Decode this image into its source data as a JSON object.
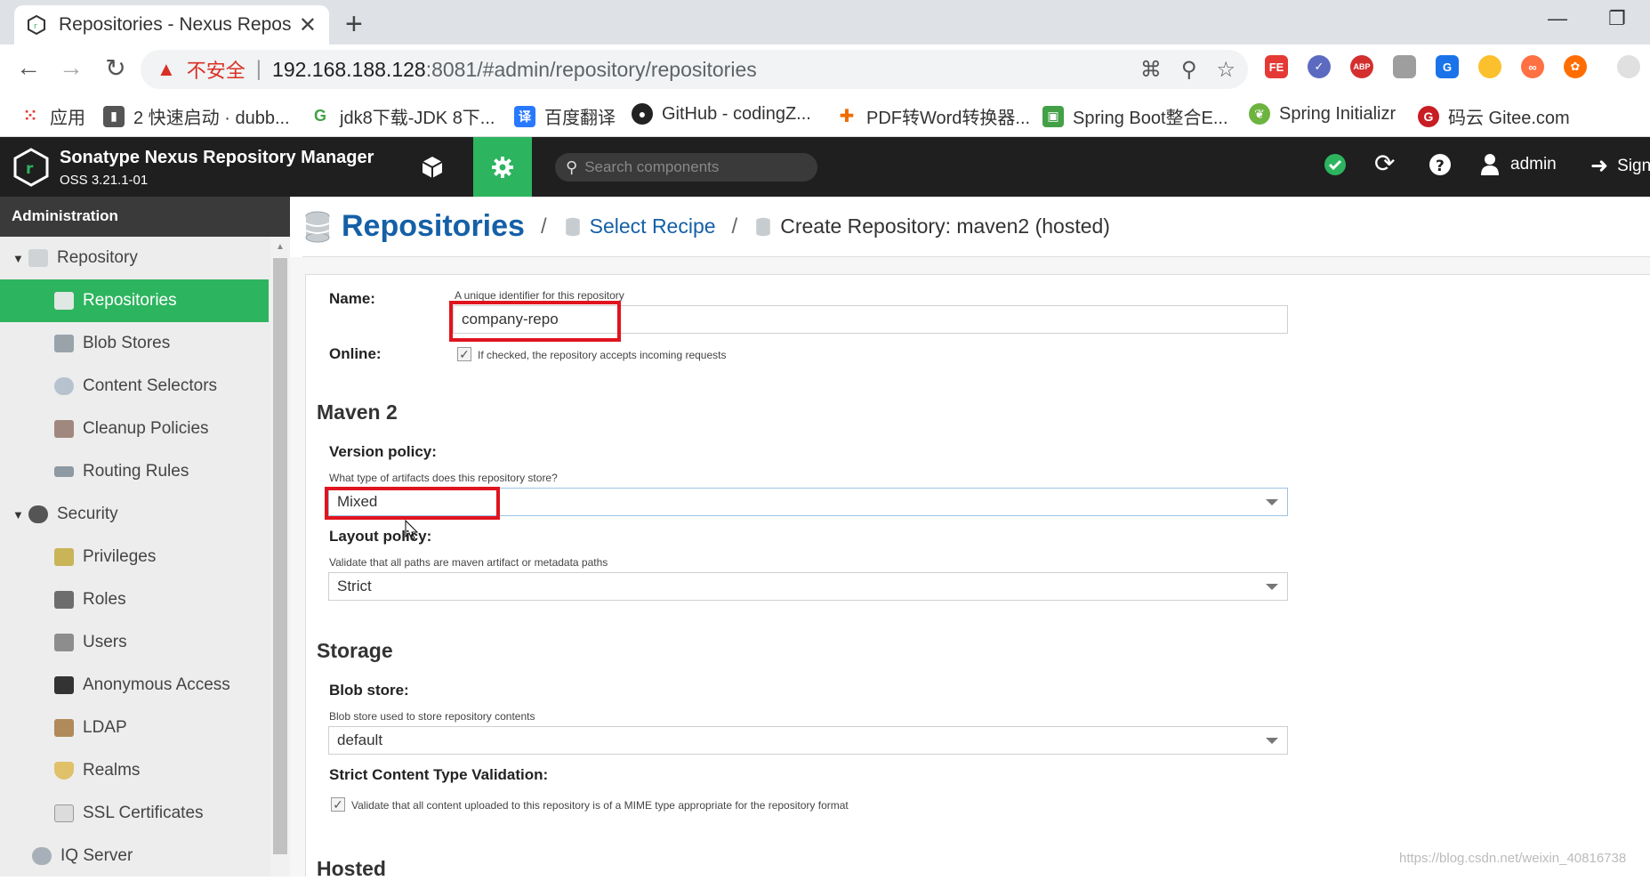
{
  "browser": {
    "tab_title": "Repositories - Nexus Repositor",
    "close_glyph": "✕",
    "newtab_glyph": "+",
    "insecure_label": "不安全",
    "url_host": "192.168.188.128",
    "url_path": ":8081/#admin/repository/repositories",
    "bookmarks": [
      {
        "label": "应用"
      },
      {
        "label": "2 快速启动 · dubb..."
      },
      {
        "label": "jdk8下载-JDK 8下..."
      },
      {
        "label": "百度翻译"
      },
      {
        "label": "GitHub - codingZ..."
      },
      {
        "label": "PDF转Word转换器..."
      },
      {
        "label": "Spring Boot整合E..."
      },
      {
        "label": "Spring Initializr"
      },
      {
        "label": "码云 Gitee.com"
      }
    ],
    "extensions": [
      "FE",
      "✓",
      "ABP",
      "",
      "G",
      "",
      "∞",
      "✿"
    ]
  },
  "nexus": {
    "product_name": "Sonatype Nexus Repository Manager",
    "version": "OSS 3.21.1-01",
    "search_placeholder": "Search components",
    "user": "admin",
    "sign_label": "Sign",
    "colors": {
      "accent": "#2db45f",
      "header": "#1f1f1f",
      "link": "#1560a7"
    }
  },
  "sidebar": {
    "header": "Administration",
    "items": [
      {
        "label": "Repository",
        "level": 1,
        "expanded": true
      },
      {
        "label": "Repositories",
        "level": 2,
        "selected": true
      },
      {
        "label": "Blob Stores",
        "level": 2
      },
      {
        "label": "Content Selectors",
        "level": 2
      },
      {
        "label": "Cleanup Policies",
        "level": 2
      },
      {
        "label": "Routing Rules",
        "level": 2
      },
      {
        "label": "Security",
        "level": 1,
        "expanded": true
      },
      {
        "label": "Privileges",
        "level": 2
      },
      {
        "label": "Roles",
        "level": 2
      },
      {
        "label": "Users",
        "level": 2
      },
      {
        "label": "Anonymous Access",
        "level": 2
      },
      {
        "label": "LDAP",
        "level": 2
      },
      {
        "label": "Realms",
        "level": 2
      },
      {
        "label": "SSL Certificates",
        "level": 2
      },
      {
        "label": "IQ Server",
        "level": 1
      }
    ]
  },
  "breadcrumb": {
    "root": "Repositories",
    "step": "Select Recipe",
    "current": "Create Repository: maven2 (hosted)"
  },
  "form": {
    "name_label": "Name:",
    "name_hint": "A unique identifier for this repository",
    "name_value": "company-repo",
    "online_label": "Online:",
    "online_hint": "If checked, the repository accepts incoming requests",
    "maven_section": "Maven 2",
    "version_label": "Version policy:",
    "version_hint": "What type of artifacts does this repository store?",
    "version_value": "Mixed",
    "layout_label": "Layout policy:",
    "layout_hint": "Validate that all paths are maven artifact or metadata paths",
    "layout_value": "Strict",
    "storage_section": "Storage",
    "blob_label": "Blob store:",
    "blob_hint": "Blob store used to store repository contents",
    "blob_value": "default",
    "strict_label": "Strict Content Type Validation:",
    "strict_hint": "Validate that all content uploaded to this repository is of a MIME type appropriate for the repository format",
    "hosted_section": "Hosted"
  },
  "watermark": "https://blog.csdn.net/weixin_40816738"
}
